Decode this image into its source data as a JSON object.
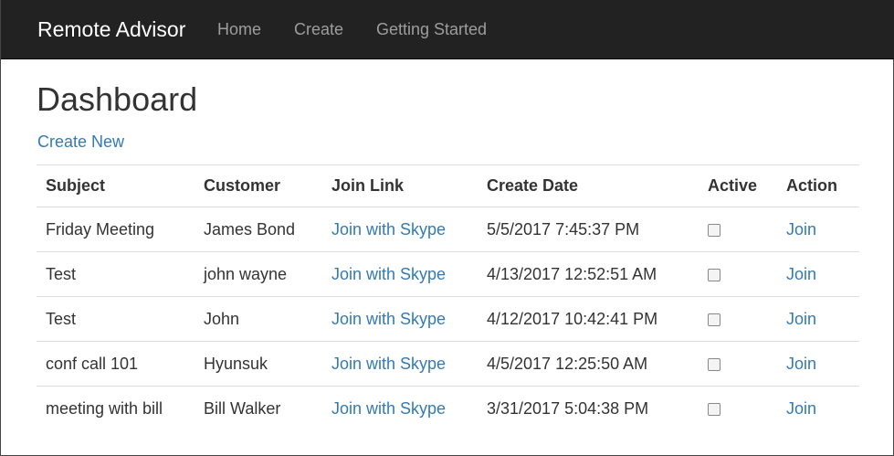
{
  "navbar": {
    "brand": "Remote Advisor",
    "links": [
      "Home",
      "Create",
      "Getting Started"
    ]
  },
  "page": {
    "title": "Dashboard",
    "create_new": "Create New"
  },
  "table": {
    "headers": [
      "Subject",
      "Customer",
      "Join Link",
      "Create Date",
      "Active",
      "Action"
    ],
    "rows": [
      {
        "subject": "Friday Meeting",
        "customer": "James Bond",
        "join_link": "Join with Skype",
        "create_date": "5/5/2017 7:45:37 PM",
        "active": false,
        "action": "Join"
      },
      {
        "subject": "Test",
        "customer": "john wayne",
        "join_link": "Join with Skype",
        "create_date": "4/13/2017 12:52:51 AM",
        "active": false,
        "action": "Join"
      },
      {
        "subject": "Test",
        "customer": "John",
        "join_link": "Join with Skype",
        "create_date": "4/12/2017 10:42:41 PM",
        "active": false,
        "action": "Join"
      },
      {
        "subject": "conf call 101",
        "customer": "Hyunsuk",
        "join_link": "Join with Skype",
        "create_date": "4/5/2017 12:25:50 AM",
        "active": false,
        "action": "Join"
      },
      {
        "subject": "meeting with bill",
        "customer": "Bill Walker",
        "join_link": "Join with Skype",
        "create_date": "3/31/2017 5:04:38 PM",
        "active": false,
        "action": "Join"
      }
    ]
  },
  "colors": {
    "navbar_bg": "#222222",
    "link": "#337ab7",
    "nav_link": "#9d9d9d"
  }
}
